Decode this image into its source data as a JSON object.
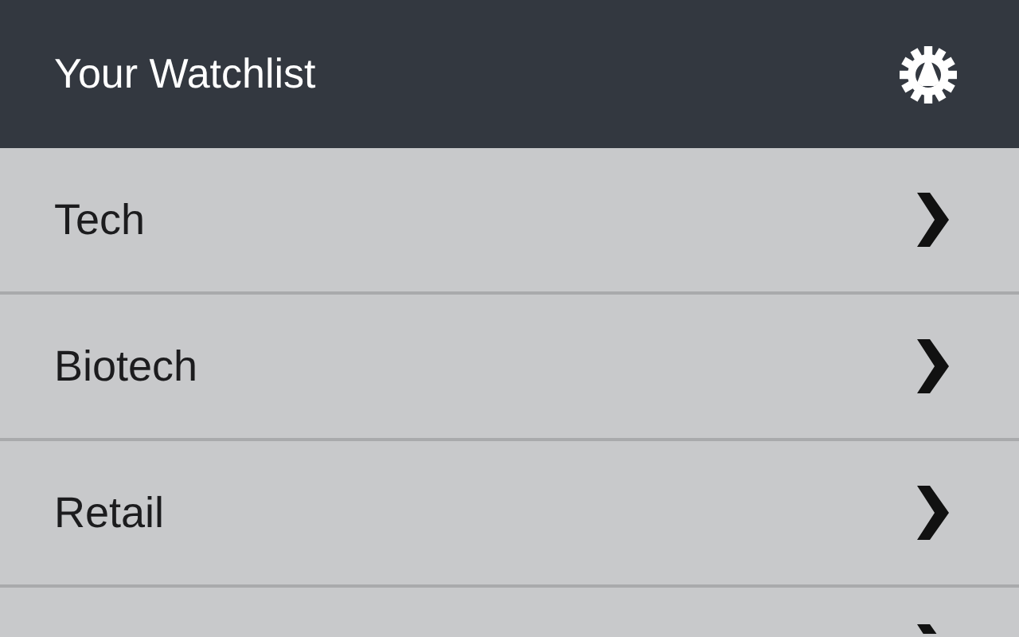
{
  "header": {
    "title": "Your Watchlist"
  },
  "watchlists": [
    {
      "kind": "full",
      "label": "Tech"
    },
    {
      "kind": "full",
      "label": "Biotech"
    },
    {
      "kind": "full",
      "label": "Retail"
    },
    {
      "kind": "partial"
    }
  ]
}
